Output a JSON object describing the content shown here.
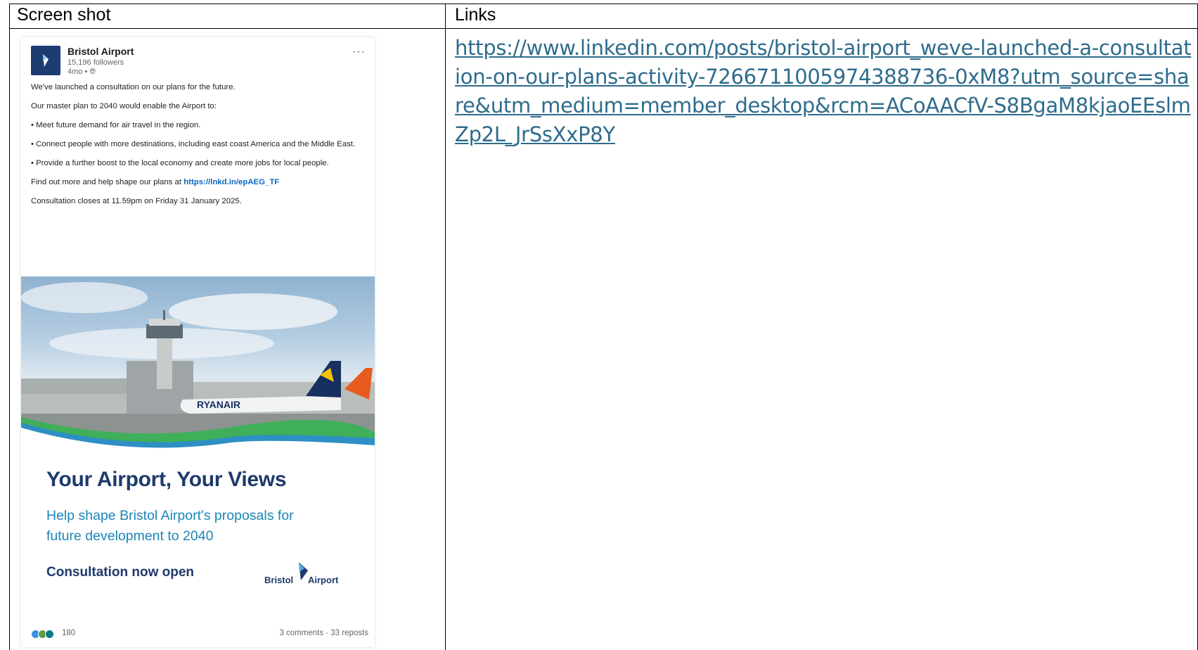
{
  "table": {
    "col1_header": "Screen shot",
    "col2_header": "Links",
    "link": "https://www.linkedin.com/posts/bristol-airport_weve-launched-a-consultation-on-our-plans-activity-7266711005974388736-0xM8?utm_source=share&utm_medium=member_desktop&rcm=ACoAACfV-S8BgaM8kjaoEEslmZp2L_JrSsXxP8Y"
  },
  "post": {
    "company": "Bristol Airport",
    "followers": "15,196 followers",
    "time": "4mo •",
    "more_icon": "more-dots-icon",
    "body": [
      "We've launched a consultation on our plans for the future.",
      "Our master plan to 2040 would enable the Airport to:",
      "• Meet future demand for air travel in the region.",
      "• Connect people with more destinations, including east coast America and the Middle East.",
      "• Provide a further boost to the local economy and create more jobs for local people."
    ],
    "find_out_prefix": "Find out more and help shape our plans at",
    "find_out_link": "https://lnkd.in/epAEG_TF",
    "closing": "Consultation closes at 11.59pm on Friday 31 January 2025.",
    "image_text": "RYANAIR",
    "promo_title": "Your Airport, Your Views",
    "promo_sub": "Help shape Bristol Airport's proposals for future development to 2040",
    "promo_cta": "Consultation now open",
    "brand_left": "Bristol",
    "brand_right": "Airport",
    "reaction_count": "180",
    "stats": "3 comments · 33 reposts"
  },
  "colors": {
    "link": "#2e6c8c",
    "navy": "#1e3a6a",
    "teal": "#1a86b8",
    "linkedin_blue": "#0a66c2"
  }
}
